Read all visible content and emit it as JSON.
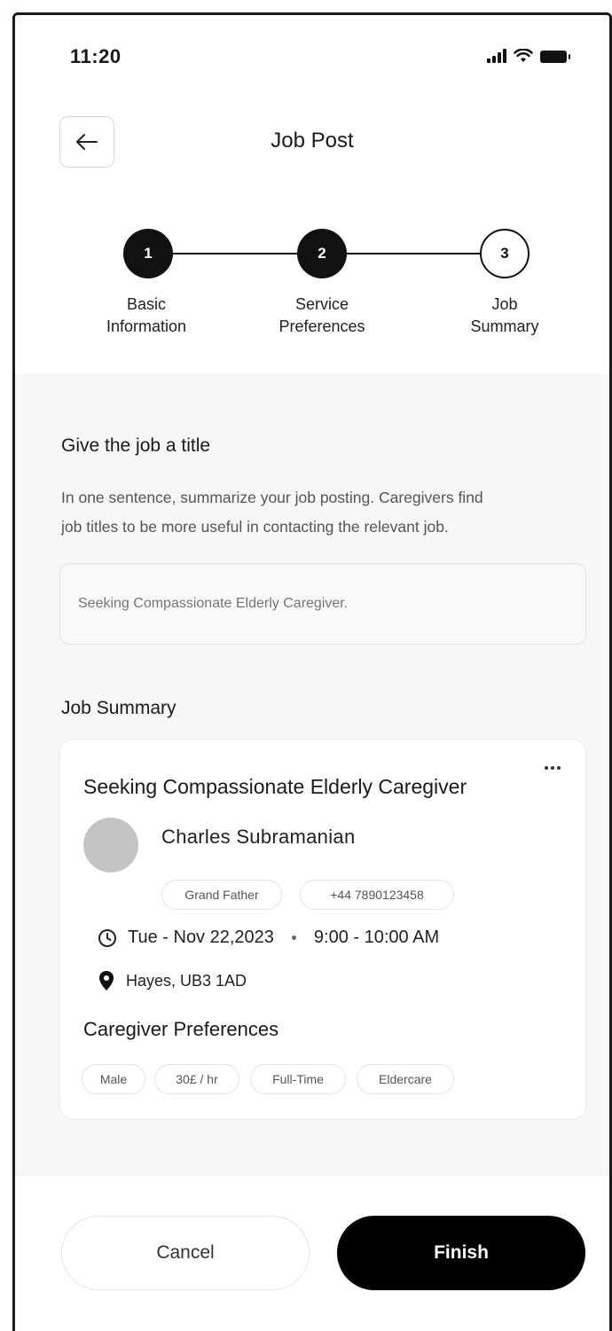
{
  "status_bar": {
    "time": "11:20"
  },
  "header": {
    "title": "Job Post"
  },
  "stepper": [
    {
      "number": "1",
      "label_line1": "Basic",
      "label_line2": "Information",
      "state": "done"
    },
    {
      "number": "2",
      "label_line1": "Service",
      "label_line2": "Preferences",
      "state": "done"
    },
    {
      "number": "3",
      "label_line1": "Job",
      "label_line2": "Summary",
      "state": "current"
    }
  ],
  "title_section": {
    "heading": "Give the job a title",
    "help_line1": "In one sentence, summarize your job posting. Caregivers find",
    "help_line2": "job titles to be more useful in contacting the relevant job.",
    "input_placeholder": "Seeking Compassionate Elderly Caregiver.",
    "input_value": ""
  },
  "summary": {
    "heading": "Job Summary",
    "card": {
      "title": "Seeking Compassionate Elderly Caregiver",
      "person_name": "Charles Subramanian",
      "relation": "Grand Father",
      "phone": "+44 7890123458",
      "date": "Tue - Nov 22,2023",
      "time": "9:00 - 10:00 AM",
      "location": "Hayes, UB3 1AD",
      "preferences_heading": "Caregiver Preferences",
      "preferences": [
        "Male",
        "30£ / hr",
        "Full-Time",
        "Eldercare"
      ]
    }
  },
  "actions": {
    "cancel_label": "Cancel",
    "finish_label": "Finish"
  },
  "colors": {
    "primary": "#000000",
    "background_section": "#f7f7f7",
    "avatar": "#c4c4c4"
  },
  "icons": [
    "back-arrow-icon",
    "signal-icon",
    "wifi-icon",
    "battery-icon",
    "more-icon",
    "clock-icon",
    "location-pin-icon"
  ]
}
